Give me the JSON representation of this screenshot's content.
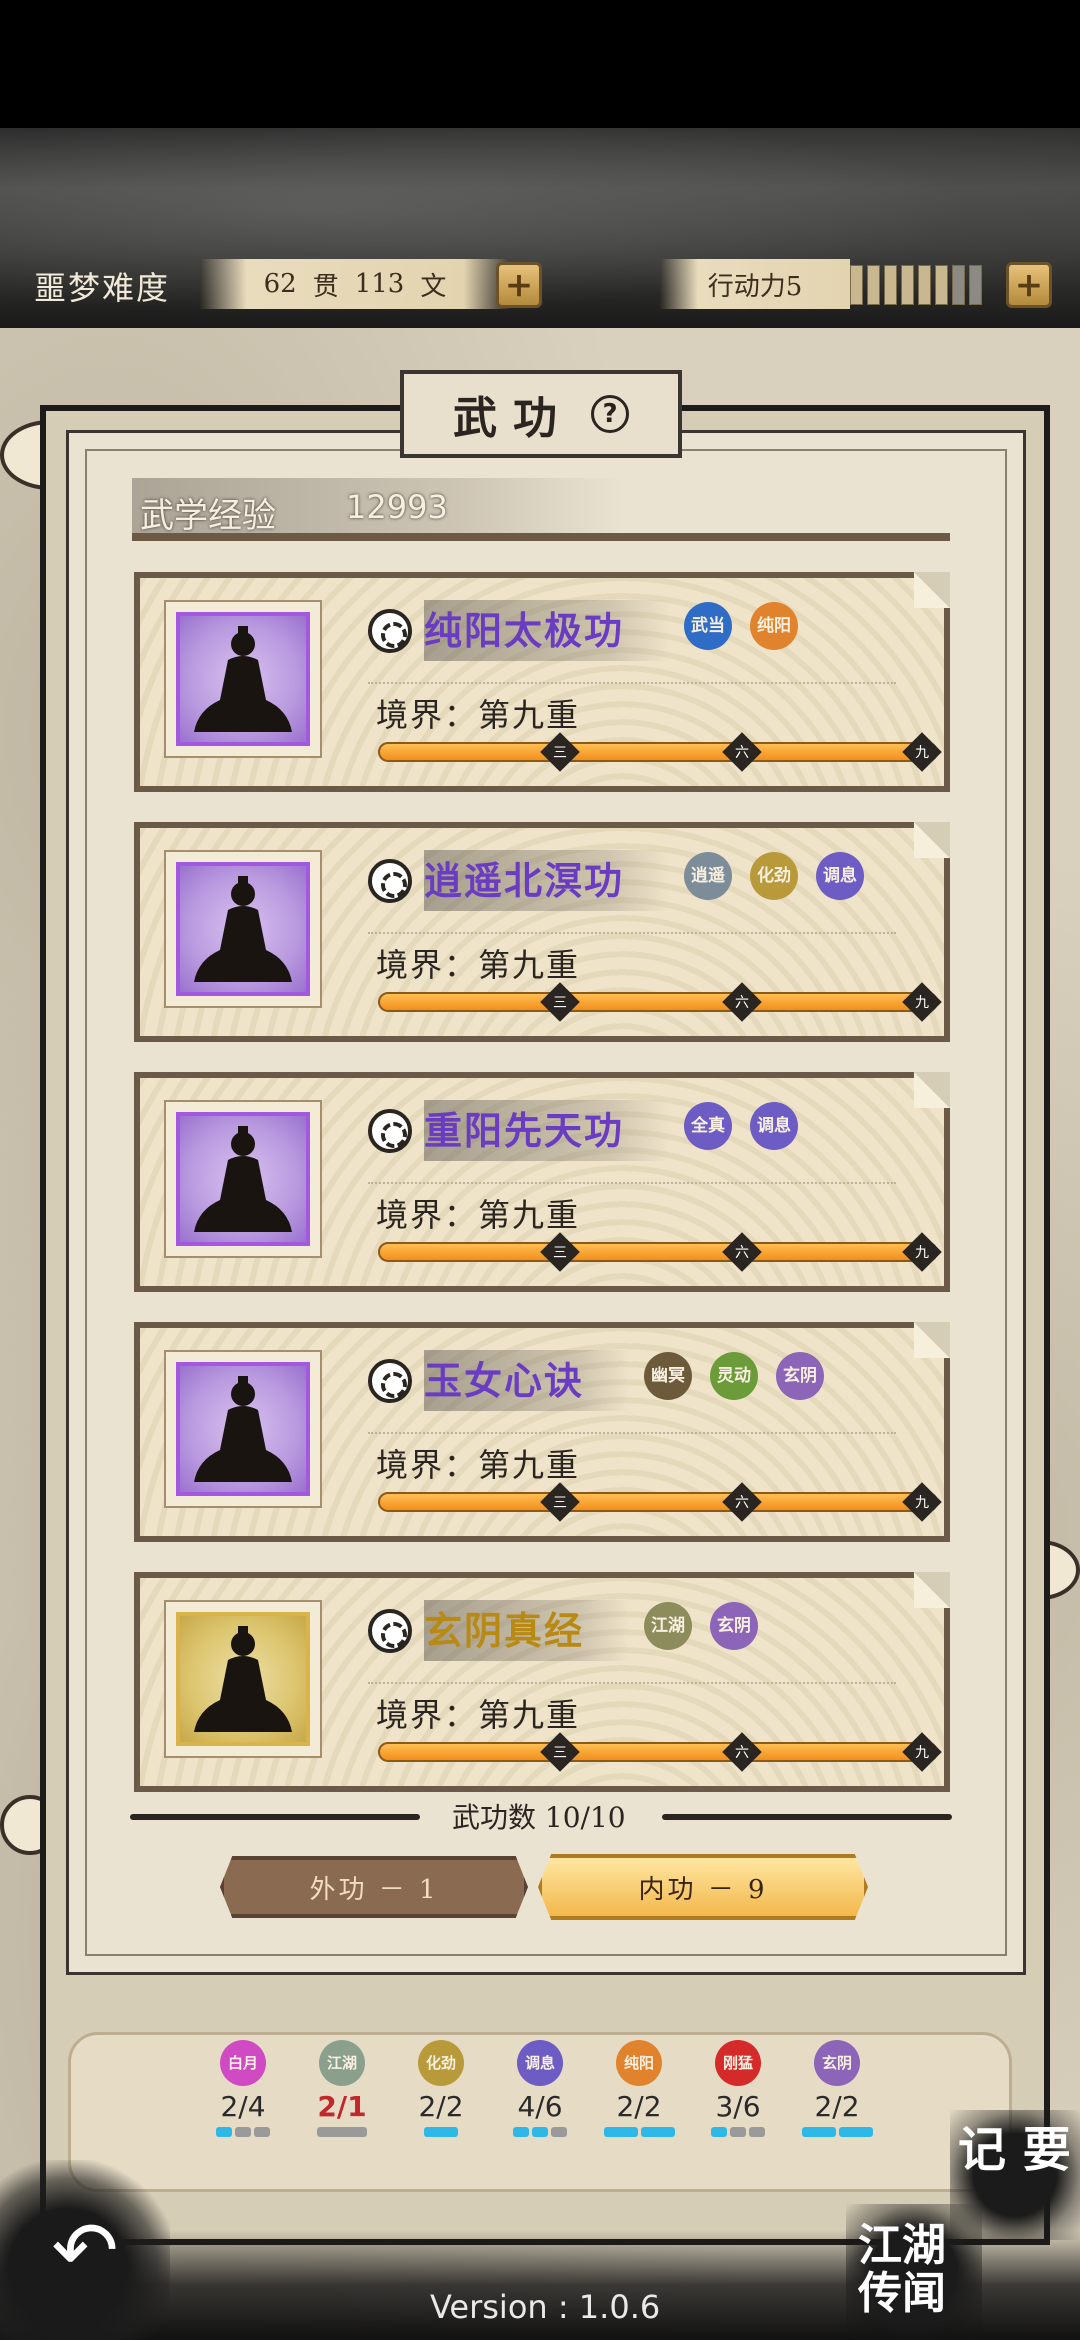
{
  "header": {
    "difficulty_label": "噩梦难度",
    "money_guan": "62",
    "money_guan_unit": "贯",
    "money_wen": "113",
    "money_wen_unit": "文",
    "action_label": "行动力5",
    "action_level": {
      "filled": 6,
      "total": 8
    },
    "plus_symbol": "+"
  },
  "panel": {
    "title": "武功",
    "help_symbol": "?",
    "exp_label": "武学经验",
    "exp_value": "12993"
  },
  "skills": [
    {
      "name": "纯阳太极功",
      "color": "purple",
      "realm": "境界：第九重",
      "tags": [
        {
          "text": "武当",
          "color": "blue"
        },
        {
          "text": "纯阳",
          "color": "orange"
        }
      ]
    },
    {
      "name": "逍遥北溟功",
      "color": "purple",
      "realm": "境界：第九重",
      "tags": [
        {
          "text": "逍遥",
          "color": "slate"
        },
        {
          "text": "化劲",
          "color": "olive"
        },
        {
          "text": "调息",
          "color": "violet"
        }
      ]
    },
    {
      "name": "重阳先天功",
      "color": "purple",
      "realm": "境界：第九重",
      "tags": [
        {
          "text": "全真",
          "color": "violet"
        },
        {
          "text": "调息",
          "color": "violet"
        }
      ]
    },
    {
      "name": "玉女心诀",
      "color": "purple",
      "realm": "境界：第九重",
      "tags": [
        {
          "text": "幽冥",
          "color": "brown"
        },
        {
          "text": "灵动",
          "color": "green"
        },
        {
          "text": "玄阴",
          "color": "purple2"
        }
      ]
    },
    {
      "name": "玄阴真经",
      "color": "gold",
      "realm": "境界：第九重",
      "tags": [
        {
          "text": "江湖",
          "color": "moss"
        },
        {
          "text": "玄阴",
          "color": "purple2"
        }
      ]
    }
  ],
  "bar_marks": [
    "三",
    "六",
    "九"
  ],
  "skill_count": "武功数 10/10",
  "tabs": {
    "external": "外功 － 1",
    "internal": "内功 － 9"
  },
  "stats": [
    {
      "tag": "白月",
      "color": "#d04ac4",
      "value": "2/4",
      "red": false
    },
    {
      "tag": "江湖",
      "color": "#8aa08c",
      "value": "2/1",
      "red": true
    },
    {
      "tag": "化劲",
      "color": "#b89a3a",
      "value": "2/2",
      "red": false
    },
    {
      "tag": "调息",
      "color": "#6c5cc4",
      "value": "4/6",
      "red": false
    },
    {
      "tag": "纯阳",
      "color": "#e0832c",
      "value": "2/2",
      "red": false
    },
    {
      "tag": "刚猛",
      "color": "#d42a2a",
      "value": "3/6",
      "red": false
    },
    {
      "tag": "玄阴",
      "color": "#8c64b8",
      "value": "2/2",
      "red": false
    }
  ],
  "bottom": {
    "notes_label": "记 要",
    "rumor_label": "江湖 传闻",
    "back_icon": "back-arrow-icon",
    "version": "Version : 1.0.6"
  }
}
